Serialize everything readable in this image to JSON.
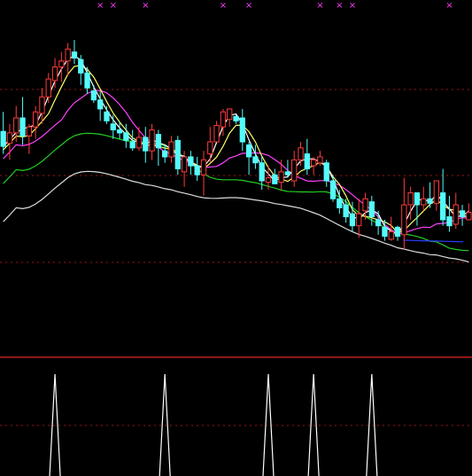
{
  "chart_data": [
    {
      "type": "candlestick",
      "panel": "price",
      "grid": "dashed-horizontal",
      "colors": {
        "background": "#000000",
        "up_candle": "#ff3b3b",
        "down_candle": "#54fcfc",
        "grid": "#a01515",
        "marker": "#ff3cff",
        "ma_white": "#ffffff",
        "ma_yellow": "#ffff66",
        "ma_magenta": "#ff40ff",
        "ma_green": "#22cc22",
        "ma_long": "#dcdcdc",
        "ma_blue": "#2b3cff"
      },
      "candles": [
        [
          209,
          199,
          222,
          194
        ],
        [
          201,
          208,
          214,
          190
        ],
        [
          208,
          218,
          226,
          202
        ],
        [
          218,
          206,
          232,
          200
        ],
        [
          206,
          212,
          214,
          194
        ],
        [
          212,
          222,
          226,
          204
        ],
        [
          221,
          232,
          238,
          214
        ],
        [
          232,
          244,
          248,
          228
        ],
        [
          243,
          252,
          258,
          238
        ],
        [
          252,
          256,
          262,
          242
        ],
        [
          256,
          264,
          268,
          246
        ],
        [
          262,
          258,
          270,
          254
        ],
        [
          257,
          248,
          260,
          240
        ],
        [
          248,
          238,
          252,
          234
        ],
        [
          236,
          230,
          240,
          228
        ],
        [
          230,
          224,
          236,
          216
        ],
        [
          222,
          216,
          226,
          214
        ],
        [
          214,
          210,
          220,
          204
        ],
        [
          210,
          208,
          216,
          204
        ],
        [
          208,
          203,
          214,
          198
        ],
        [
          202,
          198,
          210,
          196
        ],
        [
          198,
          205,
          212,
          196
        ],
        [
          205,
          196,
          212,
          188
        ],
        [
          196,
          210,
          214,
          190
        ],
        [
          207,
          198,
          210,
          186
        ],
        [
          196,
          192,
          200,
          188
        ],
        [
          192,
          202,
          206,
          188
        ],
        [
          203,
          184,
          206,
          180
        ],
        [
          182,
          192,
          196,
          172
        ],
        [
          192,
          186,
          196,
          180
        ],
        [
          186,
          180,
          192,
          176
        ],
        [
          180,
          190,
          196,
          166
        ],
        [
          194,
          202,
          212,
          188
        ],
        [
          202,
          213,
          216,
          208
        ],
        [
          212,
          222,
          224,
          206
        ],
        [
          217,
          224,
          224,
          212
        ],
        [
          219,
          216,
          220,
          214
        ],
        [
          218,
          202,
          224,
          196
        ],
        [
          200,
          192,
          202,
          180
        ],
        [
          192,
          188,
          200,
          184
        ],
        [
          188,
          176,
          192,
          170
        ],
        [
          175,
          178,
          186,
          170
        ],
        [
          180,
          174,
          184,
          174
        ],
        [
          175,
          182,
          190,
          170
        ],
        [
          182,
          180,
          190,
          178
        ],
        [
          176,
          190,
          196,
          172
        ],
        [
          190,
          198,
          202,
          186
        ],
        [
          194,
          184,
          204,
          180
        ],
        [
          186,
          190,
          192,
          180
        ],
        [
          188,
          192,
          196,
          186
        ],
        [
          188,
          176,
          190,
          172
        ],
        [
          176,
          164,
          180,
          162
        ],
        [
          164,
          158,
          170,
          154
        ],
        [
          160,
          152,
          164,
          148
        ],
        [
          154,
          146,
          162,
          142
        ],
        [
          146,
          154,
          164,
          138
        ],
        [
          156,
          164,
          168,
          150
        ],
        [
          162,
          152,
          166,
          146
        ],
        [
          150,
          146,
          156,
          140
        ],
        [
          145,
          139,
          150,
          136
        ],
        [
          137,
          142,
          152,
          136
        ],
        [
          145,
          139,
          146,
          136
        ],
        [
          140,
          160,
          178,
          130
        ],
        [
          160,
          168,
          172,
          150
        ],
        [
          168,
          160,
          166,
          146
        ],
        [
          160,
          164,
          172,
          156
        ],
        [
          164,
          161,
          175,
          158
        ],
        [
          161,
          176,
          172,
          156
        ],
        [
          168,
          150,
          184,
          146
        ],
        [
          152,
          146,
          166,
          142
        ],
        [
          147,
          160,
          168,
          144
        ],
        [
          156,
          152,
          160,
          146
        ],
        [
          150,
          155,
          161,
          150
        ]
      ],
      "moving_averages": [
        {
          "color": "white",
          "values": [
            0,
            1,
            1,
            1,
            5,
            6,
            8,
            10,
            11,
            14,
            16,
            17,
            18,
            18,
            18,
            19,
            19,
            19,
            20,
            20,
            21,
            21,
            22,
            22,
            23,
            23,
            24,
            24,
            25,
            25,
            26,
            26,
            27,
            27,
            28,
            28,
            29,
            29,
            29,
            30,
            30,
            31,
            31,
            32,
            32,
            32,
            33,
            33,
            34,
            34,
            35,
            35,
            35,
            36,
            36,
            37,
            37,
            38,
            38,
            39,
            39,
            39,
            40,
            40,
            41,
            41,
            42,
            42,
            43,
            43,
            44,
            44,
            45
          ]
        },
        {
          "color": "yellow",
          "values": [
            5,
            6,
            7,
            8,
            9,
            10,
            11,
            12,
            13,
            14,
            15,
            16,
            17,
            18,
            19,
            20,
            21,
            22,
            23,
            24,
            25,
            26,
            27,
            28,
            29,
            30,
            31,
            32,
            33,
            34,
            35,
            36,
            37,
            38,
            39,
            40,
            41,
            42,
            43,
            44,
            45,
            46,
            47,
            48,
            49,
            50,
            51,
            52,
            53,
            54,
            55,
            56,
            57,
            58,
            59,
            60,
            61,
            62,
            63,
            64,
            65,
            66,
            67,
            68,
            69,
            70,
            71,
            72,
            73,
            74,
            75,
            76,
            77
          ]
        },
        {
          "color": "magenta",
          "values": [
            10,
            11,
            12,
            13,
            14,
            15,
            16,
            17,
            18,
            19,
            20,
            21,
            22,
            23,
            24,
            25,
            26,
            27,
            28,
            29,
            30,
            31,
            32,
            33,
            34,
            35,
            36,
            37,
            38,
            39,
            40,
            41,
            42,
            43,
            44,
            45,
            46,
            47,
            48,
            49,
            50,
            51,
            52,
            53,
            54,
            55,
            56,
            57,
            58,
            59,
            60,
            61,
            62,
            63,
            64,
            65,
            66,
            67,
            68,
            69,
            70,
            71,
            72,
            73,
            74,
            75,
            76,
            77,
            78,
            79,
            80,
            81,
            82
          ]
        },
        {
          "color": "green",
          "values": [
            0,
            1,
            2,
            3,
            4,
            5,
            6,
            7,
            8,
            9,
            10,
            11,
            12,
            13,
            14,
            15,
            16,
            17,
            18,
            19,
            20,
            21,
            22,
            23,
            24,
            25,
            26,
            27,
            28,
            29,
            30,
            31,
            32,
            33,
            34,
            35,
            36,
            37,
            38,
            39,
            40,
            41,
            42,
            43,
            44,
            45,
            46,
            47,
            48,
            49,
            50,
            51,
            52,
            53,
            54,
            55,
            56,
            57,
            58,
            59,
            60,
            61,
            62,
            63,
            64,
            65,
            66,
            67,
            68,
            69,
            70,
            71,
            72
          ]
        },
        {
          "color": "long",
          "values": [
            0,
            0,
            0,
            0,
            0,
            1,
            1,
            1,
            1,
            2,
            2,
            2,
            2,
            3,
            3,
            3,
            3,
            4,
            4,
            4,
            4,
            5,
            5,
            5,
            5,
            6,
            6,
            6,
            6,
            7,
            7,
            7,
            7,
            8,
            8,
            8,
            8,
            9,
            9,
            9,
            9,
            10,
            10,
            10,
            10,
            11,
            11,
            11,
            11,
            12,
            12,
            12,
            12,
            13,
            13,
            13,
            13,
            14,
            14,
            14,
            14,
            15,
            15,
            15,
            15,
            16,
            16,
            16,
            16,
            17,
            17,
            17,
            17
          ]
        },
        {
          "color": "blue",
          "values": [
            null,
            null,
            null,
            null,
            null,
            null,
            null,
            null,
            null,
            null,
            null,
            null,
            null,
            null,
            null,
            null,
            null,
            null,
            null,
            null,
            null,
            null,
            null,
            null,
            null,
            null,
            null,
            null,
            null,
            null,
            null,
            null,
            null,
            null,
            null,
            null,
            null,
            null,
            null,
            null,
            null,
            null,
            null,
            null,
            null,
            null,
            null,
            null,
            null,
            null,
            null,
            null,
            null,
            null,
            null,
            null,
            null,
            null,
            null,
            null,
            null,
            null,
            null,
            null,
            null,
            null,
            1,
            1,
            1,
            1,
            1,
            1,
            1
          ]
        }
      ],
      "signal_markers": [
        "×",
        "×",
        "×",
        "×",
        "×",
        "×",
        "×",
        "×",
        "×"
      ],
      "marker_candle_indices": [
        15,
        17,
        22,
        34,
        38,
        49,
        52,
        54,
        69
      ]
    },
    {
      "type": "indicator",
      "panel": "signals",
      "grid": "dashed-horizontal",
      "spike_candle_indices": [
        8,
        25,
        41,
        48,
        57
      ]
    }
  ]
}
